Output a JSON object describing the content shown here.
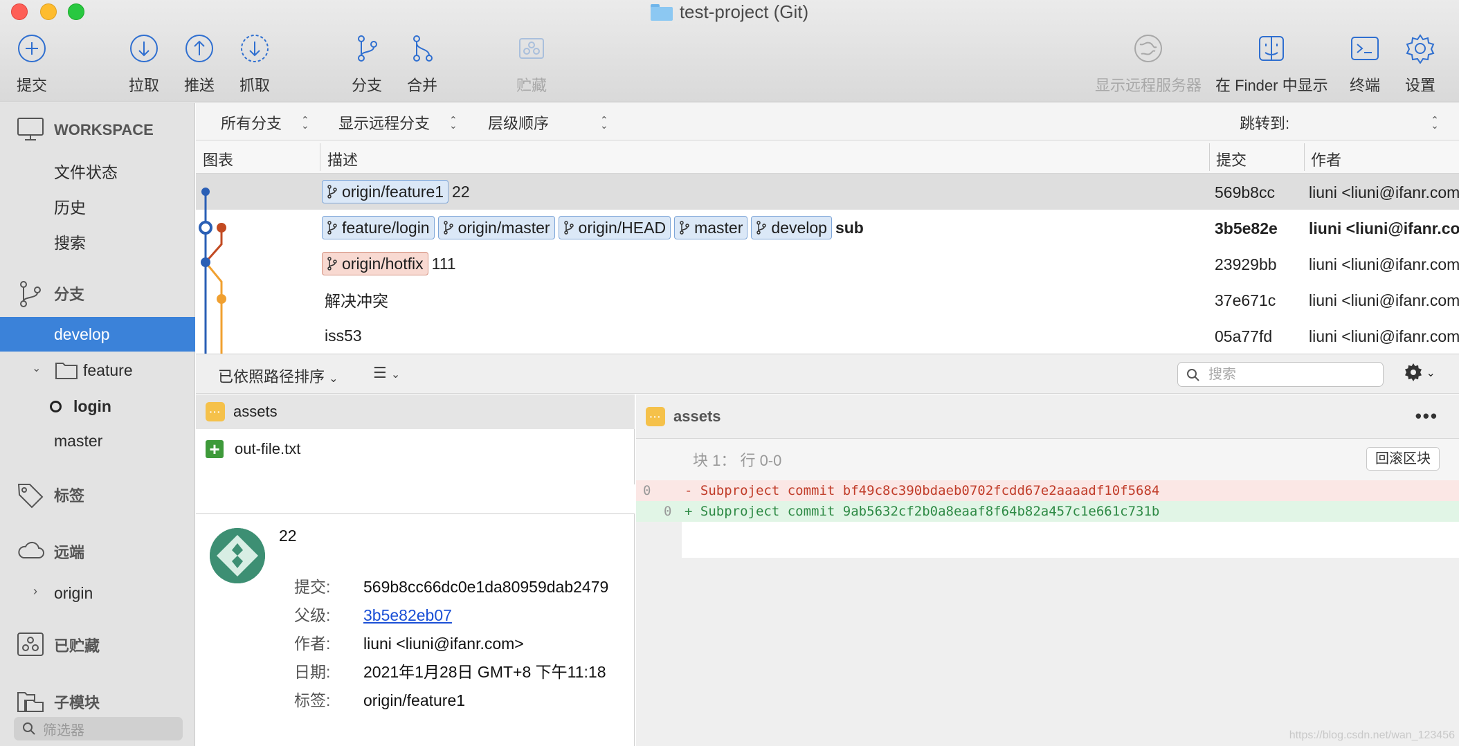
{
  "window": {
    "title": "test-project (Git)"
  },
  "toolbar": {
    "commit": "提交",
    "pull": "拉取",
    "push": "推送",
    "fetch": "抓取",
    "branch": "分支",
    "merge": "合并",
    "stash": "贮藏",
    "show_remote": "显示远程服务器",
    "show_in_finder": "在 Finder 中显示",
    "terminal": "终端",
    "settings": "设置"
  },
  "sidebar": {
    "workspace": "WORKSPACE",
    "file_status": "文件状态",
    "history": "历史",
    "search": "搜索",
    "branches": "分支",
    "branch_items": {
      "develop": "develop",
      "feature_folder": "feature",
      "login": "login",
      "master": "master"
    },
    "tags": "标签",
    "remotes": "远端",
    "origin": "origin",
    "stashes": "已贮藏",
    "submodules": "子模块",
    "filter_placeholder": "筛选器"
  },
  "history_options": {
    "all_branches": "所有分支",
    "show_remote_branches": "显示远程分支",
    "order": "层级顺序",
    "jump_to": "跳转到:"
  },
  "columns": {
    "graph": "图表",
    "description": "描述",
    "commit": "提交",
    "author": "作者"
  },
  "commits": [
    {
      "refs": [
        "origin/feature1"
      ],
      "message": "22",
      "hash": "569b8cc",
      "author": "liuni <liuni@ifanr.com>"
    },
    {
      "refs": [
        "feature/login",
        "origin/master",
        "origin/HEAD",
        "master",
        "develop"
      ],
      "message": "sub",
      "hash": "3b5e82e",
      "author": "liuni <liuni@ifanr.com>"
    },
    {
      "refs": [
        "origin/hotfix"
      ],
      "message": "111",
      "hash": "23929bb",
      "author": "liuni <liuni@ifanr.com>"
    },
    {
      "refs": [],
      "message": "解决冲突",
      "hash": "37e671c",
      "author": "liuni <liuni@ifanr.com>"
    },
    {
      "refs": [],
      "message": "iss53",
      "hash": "05a77fd",
      "author": "liuni <liuni@ifanr.com>"
    }
  ],
  "bottom_bar": {
    "sort_label": "已依照路径排序",
    "search_placeholder": "搜索"
  },
  "files": [
    {
      "name": "assets",
      "kind": "submodule"
    },
    {
      "name": "out-file.txt",
      "kind": "added"
    }
  ],
  "commit_detail": {
    "message": "22",
    "labels": {
      "commit": "提交:",
      "parent": "父级:",
      "author": "作者:",
      "date": "日期:",
      "tags": "标签:"
    },
    "commit": "569b8cc66dc0e1da80959dab2479",
    "parent": "3b5e82eb07",
    "author": "liuni <liuni@ifanr.com>",
    "date": "2021年1月28日 GMT+8 下午11:18",
    "tags": "origin/feature1"
  },
  "diff": {
    "file": "assets",
    "hunk_label": "块 1： 行 0-0",
    "hunk_button": "回滚区块",
    "lines": [
      {
        "type": "del",
        "old": "0",
        "new": "",
        "sign": "-",
        "text": "Subproject commit bf49c8c390bdaeb0702fcdd67e2aaaadf10f5684"
      },
      {
        "type": "add",
        "old": "",
        "new": "0",
        "sign": "+",
        "text": "Subproject commit 9ab5632cf2b0a8eaaf8f64b82a457c1e661c731b"
      }
    ]
  },
  "watermark": "https://blog.csdn.net/wan_123456",
  "colors": {
    "selection": "#3b82d9",
    "branch_blue": "#2a5fb5",
    "branch_red": "#c24a22",
    "branch_orange": "#f0a030"
  }
}
